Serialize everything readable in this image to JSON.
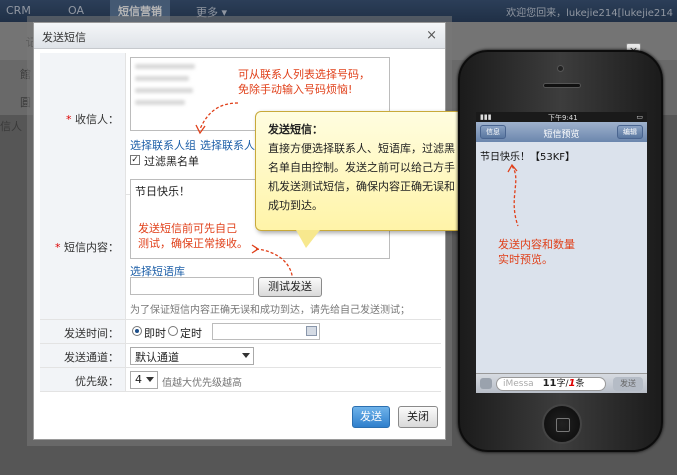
{
  "topnav": {
    "items": [
      "CRM",
      "OA",
      "短信营销",
      "更多"
    ],
    "active": "短信营销",
    "welcome": "欢迎您回来，lukejie214[lukejie214"
  },
  "background": {
    "fragments": [
      "记",
      "館",
      "圓",
      "信人"
    ]
  },
  "dialog": {
    "title": "发送短信",
    "close": "×",
    "recipients": {
      "label": "收信人：",
      "link_group": "选择联系人组",
      "link_contact": "选择联系人",
      "filter_label": "过滤黑名单",
      "annotation_line1": "可从联系人列表选择号码，",
      "annotation_line2": "免除手动输入号码烦恼!"
    },
    "content": {
      "label": "短信内容：",
      "text": "节日快乐！",
      "annotation_line1": "发送短信前可先自己",
      "annotation_line2": "测试，确保正常接收。",
      "library_link": "选择短语库",
      "test_button": "测试发送",
      "hint": "为了保证短信内容正确无误和成功到达，请先给自己发送测试；"
    },
    "send_time": {
      "label": "发送时间：",
      "option_now": "即时",
      "option_scheduled": "定时"
    },
    "channel": {
      "label": "发送通道：",
      "value": "默认通道"
    },
    "priority": {
      "label": "优先级：",
      "value": "4",
      "hint": "值越大优先级越高"
    },
    "send_button": "发送",
    "close_button": "关闭"
  },
  "tooltip": {
    "title": "发送短信：",
    "body": "直接方便选择联系人、短语库，过滤黑名单自由控制。发送之前可以给己方手机发送测试短信，确保内容正确无误和成功到达。"
  },
  "phone": {
    "time": "下午9:41",
    "back": "信息",
    "title": "短信预览",
    "edit": "编辑",
    "message": "节日快乐！【53KF】",
    "annotation_line1": "发送内容和数量",
    "annotation_line2": "实时预览。",
    "input_placeholder": "iMessa",
    "count_chars": "11",
    "count_chars_unit": "字/",
    "count_msgs": "1",
    "count_msgs_unit": "条",
    "send": "发送",
    "close": "×"
  }
}
